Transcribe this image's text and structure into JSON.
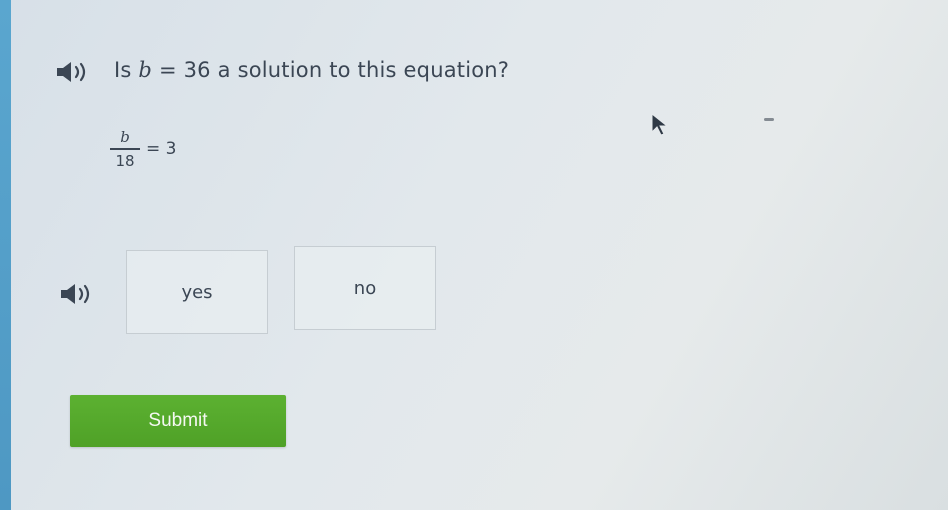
{
  "question": {
    "prefix": "Is ",
    "variable": "b",
    "equals": " = 36 ",
    "suffix": "a solution to this equation?"
  },
  "equation": {
    "numerator": "b",
    "denominator": "18",
    "rhs": "= 3"
  },
  "choices": [
    {
      "label": "yes"
    },
    {
      "label": "no"
    }
  ],
  "submit": {
    "label": "Submit"
  },
  "colors": {
    "submit_bg": "#5cb131",
    "accent_edge": "#5aa6cf",
    "text": "#3b4654"
  },
  "icons": {
    "question_audio": "speaker-icon",
    "choices_audio": "speaker-icon",
    "pointer": "mouse-cursor-icon"
  }
}
